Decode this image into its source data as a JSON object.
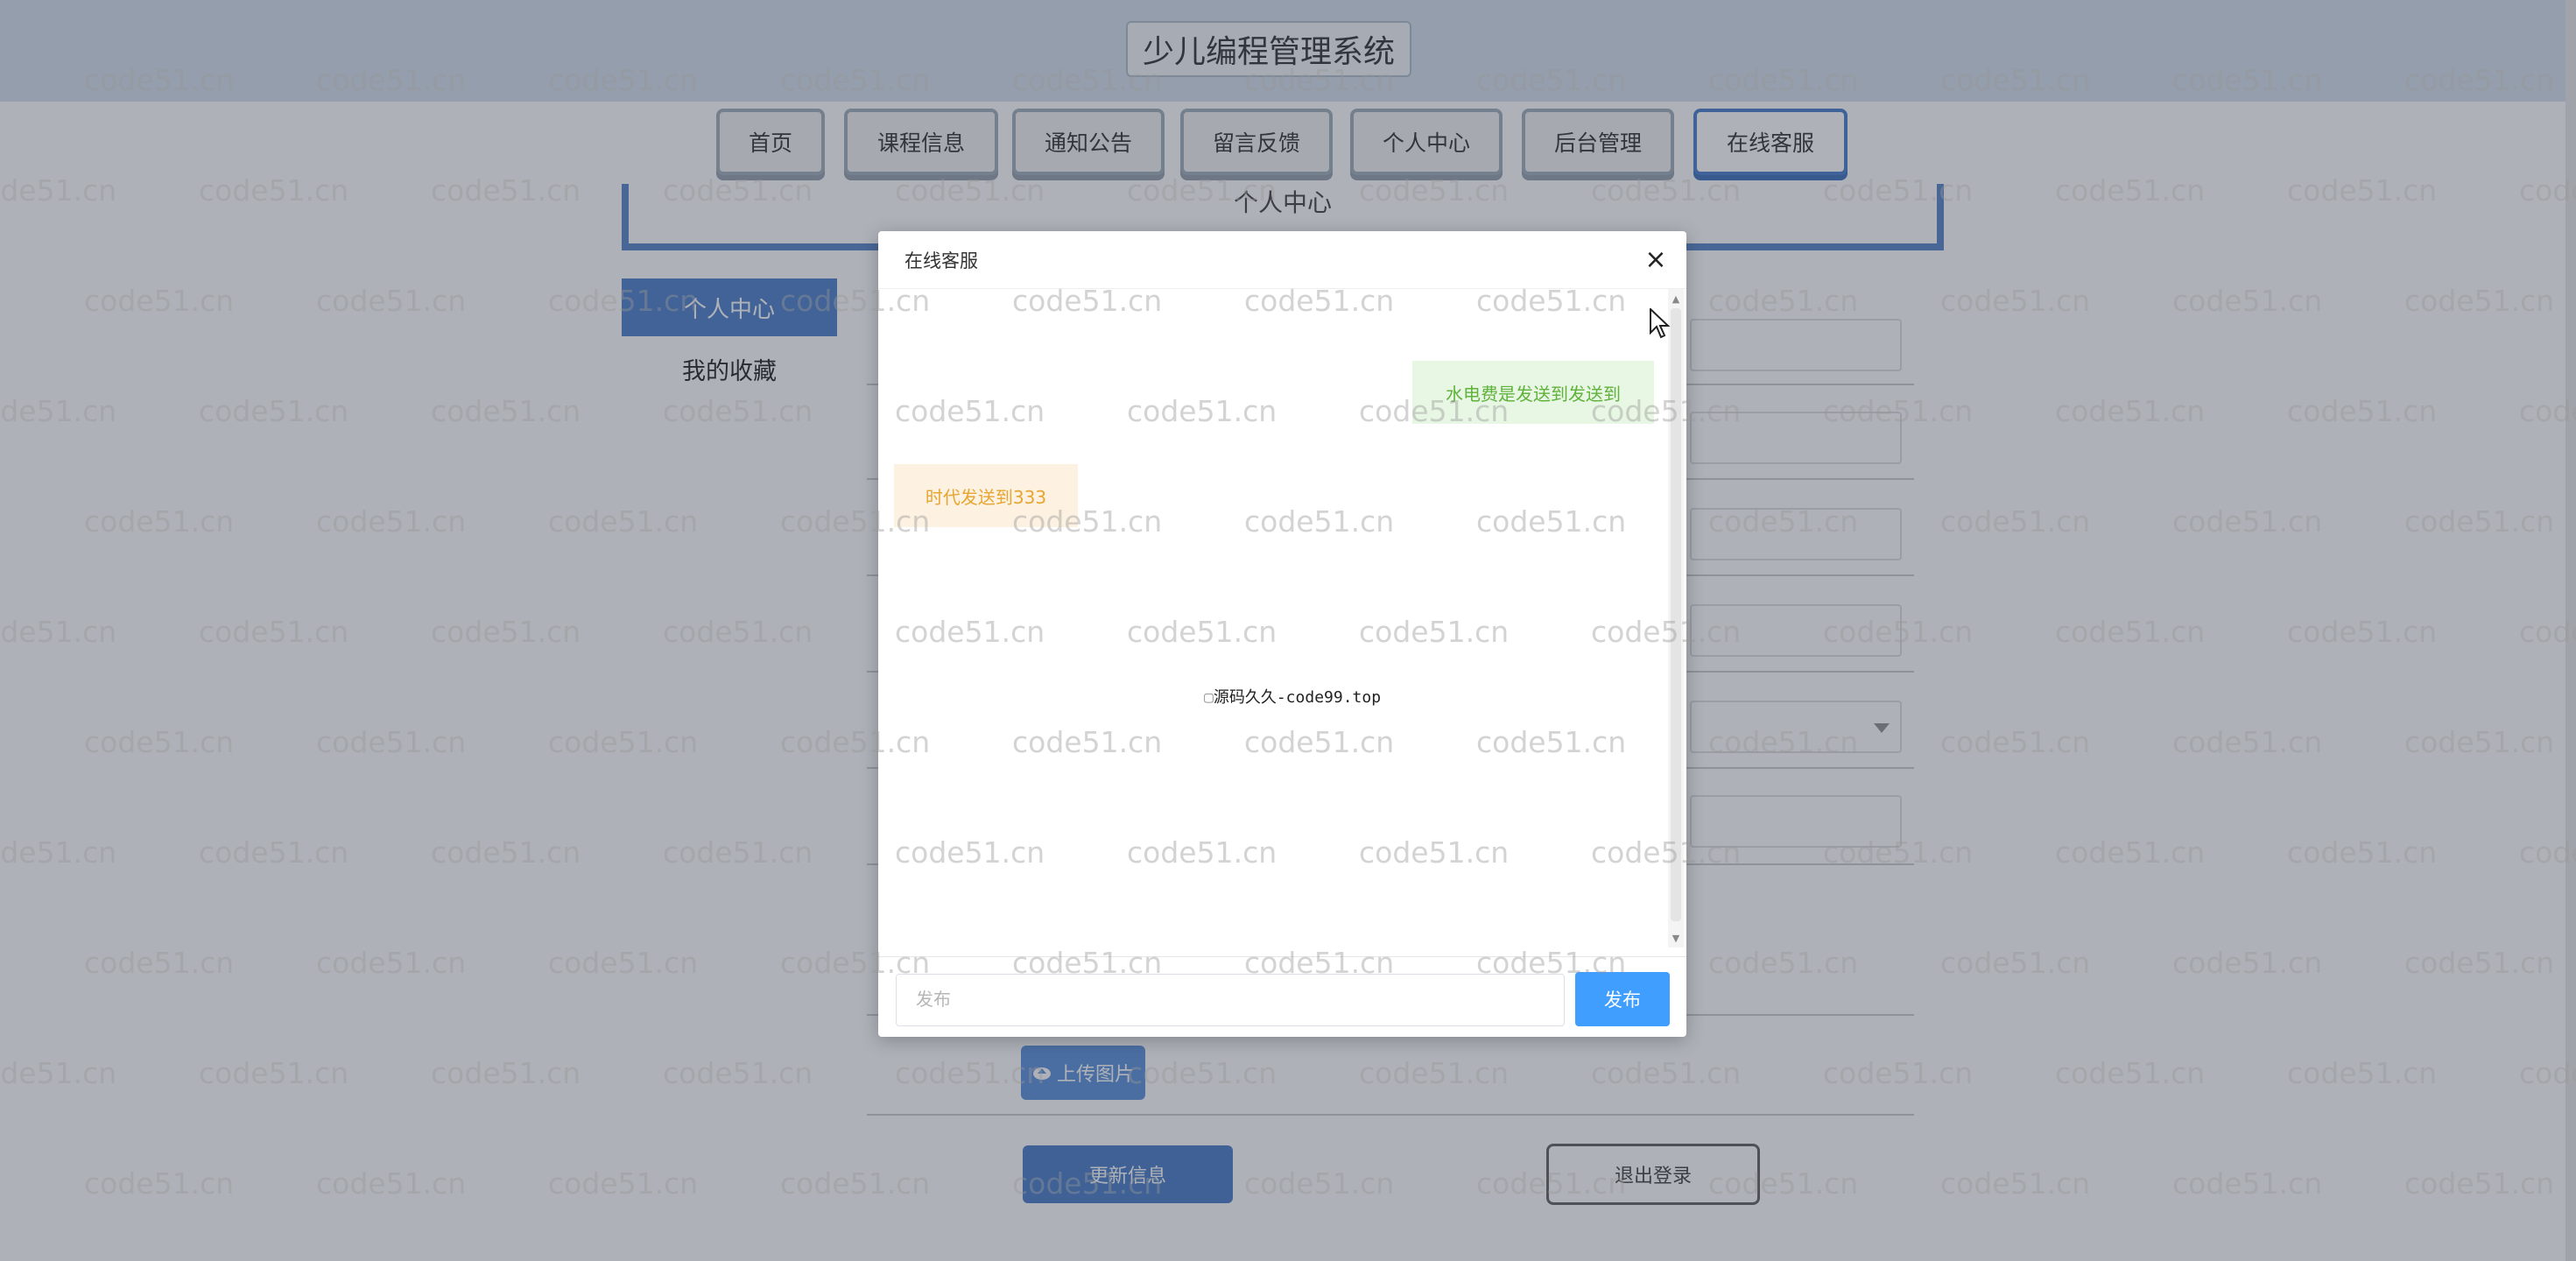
{
  "site": {
    "title": "少儿编程管理系统"
  },
  "nav": {
    "items": [
      {
        "label": "首页"
      },
      {
        "label": "课程信息"
      },
      {
        "label": "通知公告"
      },
      {
        "label": "留言反馈"
      },
      {
        "label": "个人中心"
      },
      {
        "label": "后台管理"
      },
      {
        "label": "在线客服",
        "active": true
      }
    ]
  },
  "page": {
    "breadcrumb": "个人中心",
    "sidebar": {
      "active_label": "个人中心",
      "items": [
        {
          "label": "我的收藏"
        }
      ]
    },
    "upload_label": "上传图片",
    "update_label": "更新信息",
    "logout_label": "退出登录"
  },
  "modal": {
    "title": "在线客服",
    "close_glyph": "×",
    "messages": [
      {
        "side": "right",
        "text": "水电费是发送到发送到"
      },
      {
        "side": "left",
        "text": "时代发送到333"
      }
    ],
    "center_note": "源码久久-code99.top",
    "input": {
      "value": "",
      "placeholder": "发布"
    },
    "send_label": "发布"
  },
  "watermark": {
    "text": "code51.cn"
  },
  "colors": {
    "accent": "#409eff",
    "nav_active_border": "#3a72c8",
    "sidebar_active": "#3f72c5",
    "msg_right_bg": "#e8f6e4",
    "msg_right_text": "#5fb23a",
    "msg_left_bg": "#fdf1e1",
    "msg_left_text": "#e7a531"
  }
}
